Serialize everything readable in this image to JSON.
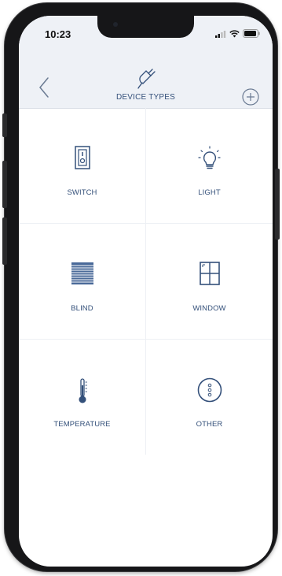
{
  "status_bar": {
    "time": "10:23"
  },
  "header": {
    "title": "DEVICE TYPES"
  },
  "device_types": [
    {
      "label": "SWITCH",
      "icon": "switch-icon"
    },
    {
      "label": "LIGHT",
      "icon": "lightbulb-icon"
    },
    {
      "label": "BLIND",
      "icon": "blind-icon"
    },
    {
      "label": "WINDOW",
      "icon": "window-icon"
    },
    {
      "label": "TEMPERATURE",
      "icon": "thermometer-icon"
    },
    {
      "label": "OTHER",
      "icon": "other-dots-icon"
    }
  ],
  "colors": {
    "accent": "#34507a",
    "header_bg": "#eef1f6"
  }
}
